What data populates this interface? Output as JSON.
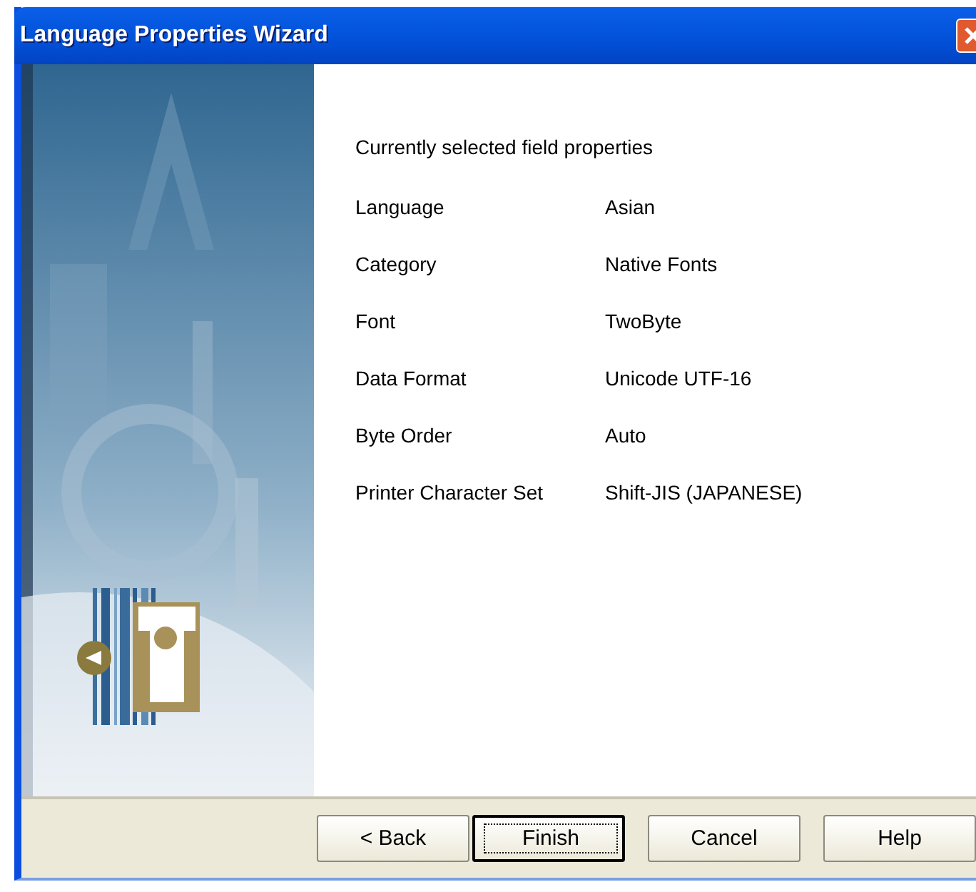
{
  "window": {
    "title": "Language Properties Wizard"
  },
  "heading": "Currently selected field properties",
  "properties": [
    {
      "label": "Language",
      "value": "Asian"
    },
    {
      "label": "Category",
      "value": "Native Fonts"
    },
    {
      "label": "Font",
      "value": "TwoByte"
    },
    {
      "label": "Data Format",
      "value": "Unicode UTF-16"
    },
    {
      "label": "Byte Order",
      "value": "Auto"
    },
    {
      "label": "Printer Character Set",
      "value": "Shift-JIS (JAPANESE)"
    }
  ],
  "buttons": [
    {
      "label": "< Back",
      "default": false
    },
    {
      "label": "Finish",
      "default": true
    },
    {
      "label": "Cancel",
      "default": false
    },
    {
      "label": "Help",
      "default": false
    }
  ]
}
